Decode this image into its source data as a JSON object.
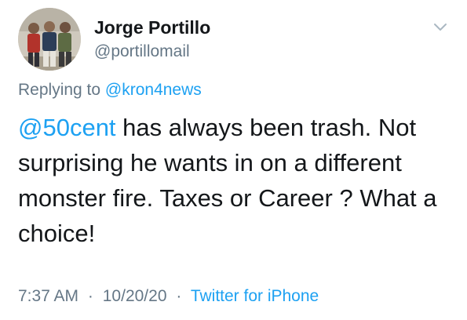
{
  "author": {
    "display_name": "Jorge Portillo",
    "handle": "@portillomail",
    "avatar_icon": "profile-photo"
  },
  "reply_context": {
    "prefix": "Replying to",
    "mention": "@kron4news"
  },
  "tweet": {
    "mention": "@50cent",
    "body": " has always been trash. Not surprising he wants in on a different monster fire. Taxes or Career ? What a choice!"
  },
  "meta": {
    "time": "7:37 AM",
    "separator": "·",
    "date": "10/20/20",
    "source": "Twitter for iPhone"
  },
  "menu": {
    "icon": "chevron-down-icon"
  },
  "colors": {
    "link": "#1da1f2",
    "secondary_text": "#657786",
    "primary_text": "#14171a"
  }
}
